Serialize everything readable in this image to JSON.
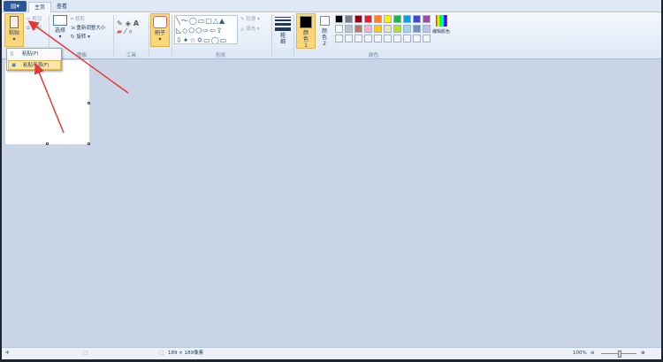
{
  "tabs": [
    "主页",
    "查看"
  ],
  "clipboard": {
    "paste": "粘贴",
    "cut": "剪切",
    "copy": "复制",
    "menu": [
      {
        "label": "粘贴(P)"
      },
      {
        "label": "粘贴来源(F)"
      }
    ]
  },
  "image": {
    "label": "图像",
    "select": "选择",
    "crop": "裁剪",
    "resize": "重新调整大小",
    "rotate": "旋转"
  },
  "tools": {
    "label": "工具"
  },
  "brushes": {
    "label": "刷子"
  },
  "shapes": {
    "label": "形状",
    "outline": "轮廓",
    "fill": "填充",
    "glyphs": [
      "╲〜◯▭▢△▲",
      "◺◇⬠⬡⇨⇦⇧",
      "⇩✦☆✡▭◯▭"
    ]
  },
  "size": {
    "label": "粗细"
  },
  "color1": {
    "label": "颜色 1",
    "value": "#000000"
  },
  "color2": {
    "label": "颜色 2",
    "value": "#ffffff"
  },
  "colors": {
    "label": "颜色",
    "edit": "编辑颜色",
    "palette": [
      "#000000",
      "#7f7f7f",
      "#880015",
      "#ed1c24",
      "#ff7f27",
      "#fff200",
      "#22b14c",
      "#00a2e8",
      "#3f48cc",
      "#a349a4",
      "#ffffff",
      "#c3c3c3",
      "#b97a57",
      "#ffaec9",
      "#ffc90e",
      "#efe4b0",
      "#b5e61d",
      "#99d9ea",
      "#7092be",
      "#c8bfe7"
    ]
  },
  "status": {
    "size": "189 × 189像素",
    "zoom": "100%"
  }
}
